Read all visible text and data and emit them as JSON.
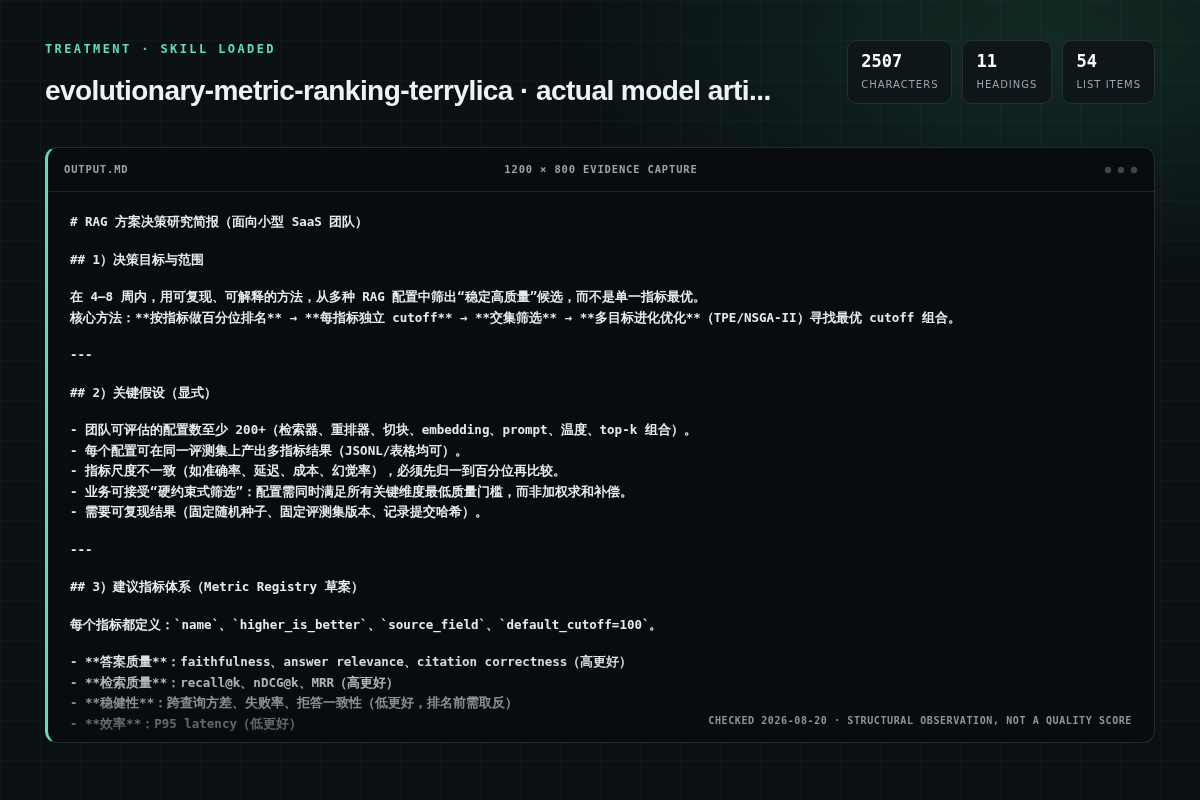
{
  "eyebrow": "TREATMENT · SKILL LOADED",
  "title": "evolutionary-metric-ranking-terrylica · actual model arti...",
  "stats": [
    {
      "value": "2507",
      "label": "CHARACTERS"
    },
    {
      "value": "11",
      "label": "HEADINGS"
    },
    {
      "value": "54",
      "label": "LIST ITEMS"
    }
  ],
  "panel": {
    "filename": "OUTPUT.MD",
    "caption": "1200 × 800 EVIDENCE CAPTURE",
    "blocks": [
      [
        "# RAG 方案决策研究简报（面向小型 SaaS 团队）"
      ],
      [
        "## 1）决策目标与范围"
      ],
      [
        "在 4–8 周内，用可复现、可解释的方法，从多种 RAG 配置中筛出“稳定高质量”候选，而不是单一指标最优。",
        "核心方法：**按指标做百分位排名** → **每指标独立 cutoff** → **交集筛选** → **多目标进化优化**（TPE/NSGA-II）寻找最优 cutoff 组合。"
      ],
      [
        "---"
      ],
      [
        "## 2）关键假设（显式）"
      ],
      [
        "- 团队可评估的配置数至少 200+（检索器、重排器、切块、embedding、prompt、温度、top-k 组合）。",
        "- 每个配置可在同一评测集上产出多指标结果（JSONL/表格均可）。",
        "- 指标尺度不一致（如准确率、延迟、成本、幻觉率），必须先归一到百分位再比较。",
        "- 业务可接受“硬约束式筛选”：配置需同时满足所有关键维度最低质量门槛，而非加权求和补偿。",
        "- 需要可复现结果（固定随机种子、固定评测集版本、记录提交哈希）。"
      ],
      [
        "---"
      ],
      [
        "## 3）建议指标体系（Metric Registry 草案）"
      ],
      [
        "每个指标都定义：`name`、`higher_is_better`、`source_field`、`default_cutoff=100`。"
      ],
      [
        "- **答案质量**：faithfulness、answer relevance、citation correctness（高更好）",
        "- **检索质量**：recall@k、nDCG@k、MRR（高更好）",
        "- **稳健性**：跨查询方差、失败率、拒答一致性（低更好，排名前需取反）",
        "- **效率**：P95 latency（低更好）"
      ]
    ],
    "footer": "CHECKED 2026-08-20 · STRUCTURAL OBSERVATION, NOT A QUALITY SCORE"
  }
}
